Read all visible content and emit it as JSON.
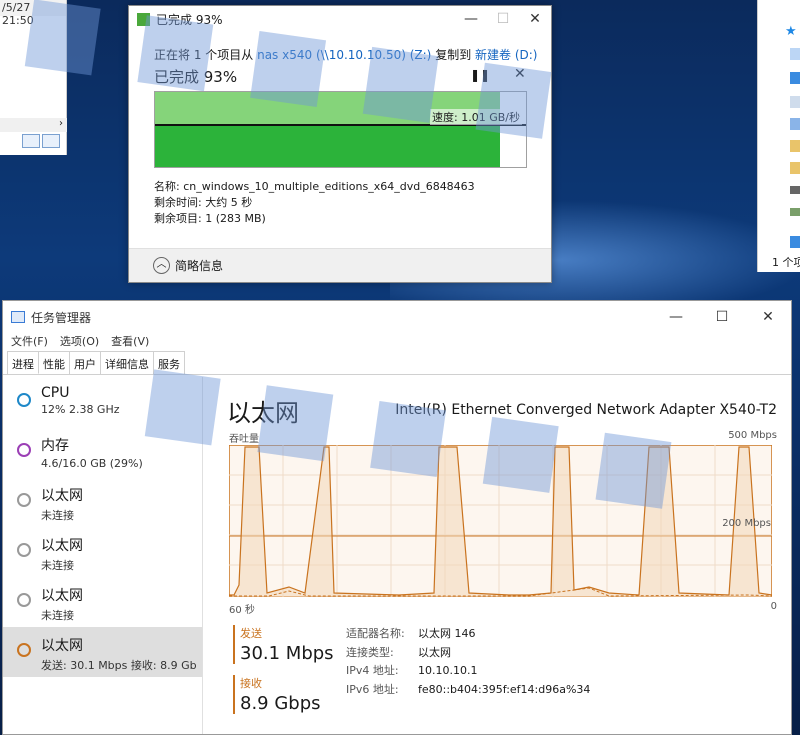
{
  "background": {
    "timestamp": "/5/27 21:50",
    "explorer_count": "1 个项"
  },
  "copy_dialog": {
    "title": "已完成 93%",
    "line_prefix": "正在将 1 个项目从",
    "source": "nas x540 (\\\\10.10.10.50) (Z:)",
    "line_mid": "复制到",
    "destination": "新建卷 (D:)",
    "status": "已完成 93%",
    "progress_percent": 93,
    "speed_label": "速度: 1.01 GB/秒",
    "name_line": "名称: cn_windows_10_multiple_editions_x64_dvd_6848463",
    "time_line": "剩余时间: 大约 5 秒",
    "items_line": "剩余项目: 1 (283 MB)",
    "details_toggle": "简略信息"
  },
  "task_manager": {
    "title": "任务管理器",
    "menu": [
      "文件(F)",
      "选项(O)",
      "查看(V)"
    ],
    "tabs": [
      "进程",
      "性能",
      "用户",
      "详细信息",
      "服务"
    ],
    "active_tab": 1,
    "sidebar": [
      {
        "name": "CPU",
        "sub": "12% 2.38 GHz",
        "color": "#1e88c8"
      },
      {
        "name": "内存",
        "sub": "4.6/16.0 GB (29%)",
        "color": "#9b3fb5"
      },
      {
        "name": "以太网",
        "sub": "未连接",
        "color": "#999999"
      },
      {
        "name": "以太网",
        "sub": "未连接",
        "color": "#999999"
      },
      {
        "name": "以太网",
        "sub": "未连接",
        "color": "#999999"
      },
      {
        "name": "以太网",
        "sub": "发送: 30.1 Mbps 接收: 8.9 Gb",
        "color": "#c9731f"
      }
    ],
    "selected_index": 5,
    "panel_title": "以太网",
    "adapter": "Intel(R) Ethernet Converged Network Adapter X540-T2",
    "throughput_label": "吞吐量",
    "max_label": "500 Mbps",
    "mid_label": "200 Mbps",
    "time_label": "60 秒",
    "zero_label": "0",
    "send_label": "发送",
    "send_value": "30.1 Mbps",
    "recv_label": "接收",
    "recv_value": "8.9 Gbps",
    "props": [
      {
        "k": "适配器名称:",
        "v": "以太网 146"
      },
      {
        "k": "连接类型:",
        "v": "以太网"
      },
      {
        "k": "IPv4 地址:",
        "v": "10.10.10.1"
      },
      {
        "k": "IPv6 地址:",
        "v": "fe80::b404:395f:ef14:d96a%34"
      }
    ],
    "accent": "#c9731f"
  }
}
